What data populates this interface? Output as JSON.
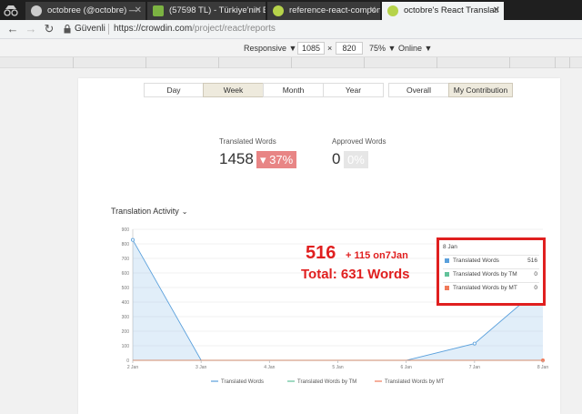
{
  "browser": {
    "tabs": [
      {
        "title": "octobree (@octobre) —",
        "icon": "github-icon",
        "color": "#cccccc"
      },
      {
        "title": "(57598 TL) - Türkiye'nin E",
        "icon": "p-icon",
        "color": "#7cb342"
      },
      {
        "title": "reference-react-compon",
        "icon": "crowdin-icon",
        "color": "#b6d34a"
      },
      {
        "title": "octobre's React Translati",
        "icon": "crowdin-icon",
        "color": "#b6d34a"
      }
    ],
    "secure_label": "Güvenli",
    "url_host": "https://crowdin.com",
    "url_path": "/project/react/reports"
  },
  "devtools": {
    "mode": "Responsive ▼",
    "width": "1085",
    "times": "×",
    "height": "820",
    "zoom": "75% ▼",
    "network": "Online ▼"
  },
  "filters": {
    "periods": [
      "Day",
      "Week",
      "Month",
      "Year"
    ],
    "active_period": "Week",
    "scopes": [
      "Overall",
      "My Contribution"
    ],
    "active_scope": "My Contribution"
  },
  "stats": {
    "translated_label": "Translated Words",
    "translated_value": "1458",
    "translated_change": "▾ 37%",
    "approved_label": "Approved Words",
    "approved_value": "0",
    "approved_change": "0%"
  },
  "activity_title": "Translation Activity",
  "chart_data": {
    "type": "area",
    "x": [
      "2 Jan",
      "3 Jan",
      "4 Jan",
      "5 Jan",
      "6 Jan",
      "7 Jan",
      "8 Jan"
    ],
    "ylim": [
      0,
      900
    ],
    "yticks": [
      0,
      100,
      200,
      300,
      400,
      500,
      600,
      700,
      800,
      900
    ],
    "series": [
      {
        "name": "Translated Words",
        "values": [
          827,
          0,
          0,
          0,
          0,
          115,
          516
        ],
        "color": "#5aa0dc"
      },
      {
        "name": "Translated Words by TM",
        "values": [
          0,
          0,
          0,
          0,
          0,
          0,
          0
        ],
        "color": "#62c29a"
      },
      {
        "name": "Translated Words by MT",
        "values": [
          0,
          0,
          0,
          0,
          0,
          0,
          0
        ],
        "color": "#f07a5a"
      }
    ],
    "legend": "bottom",
    "grid": true
  },
  "tooltip": {
    "date": "8 Jan",
    "rows": [
      {
        "label": "Translated Words",
        "value": "516",
        "color": "#5aa0dc"
      },
      {
        "label": "Translated Words by TM",
        "value": "0",
        "color": "#62c29a"
      },
      {
        "label": "Translated Words by MT",
        "value": "0",
        "color": "#f07a5a"
      }
    ]
  },
  "annotation": {
    "big": "516",
    "small": "+ 115 on7Jan",
    "total": "Total: 631 Words",
    "color": "#e01f1f"
  }
}
